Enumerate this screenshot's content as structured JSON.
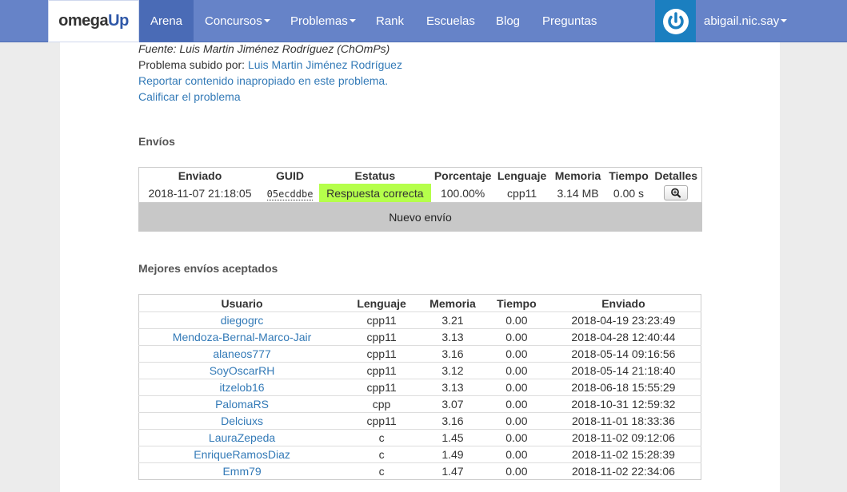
{
  "nav": {
    "brand_part1": "omega",
    "brand_part2": "Up",
    "arena": "Arena",
    "concursos": "Concursos",
    "problemas": "Problemas",
    "rank": "Rank",
    "escuelas": "Escuelas",
    "blog": "Blog",
    "preguntas": "Preguntas",
    "username": "abigail.nic.say"
  },
  "meta": {
    "source": "Fuente: Luis Martin Jiménez Rodríguez (ChOmPs)",
    "uploaded_by_label": "Problema subido por:",
    "uploaded_by_name": "Luis Martin Jiménez Rodríguez",
    "report_link": "Reportar contenido inapropiado en este problema.",
    "rate_link": "Calificar el problema"
  },
  "submissions": {
    "title": "Envíos",
    "headers": [
      "Enviado",
      "GUID",
      "Estatus",
      "Porcentaje",
      "Lenguaje",
      "Memoria",
      "Tiempo",
      "Detalles"
    ],
    "rows": [
      {
        "sent": "2018-11-07 21:18:05",
        "guid": "05ecddbe",
        "status": "Respuesta correcta",
        "percent": "100.00%",
        "lang": "cpp11",
        "memory": "3.14 MB",
        "time": "0.00 s"
      }
    ],
    "new_submission": "Nuevo envío"
  },
  "best": {
    "title": "Mejores envíos aceptados",
    "headers": [
      "Usuario",
      "Lenguaje",
      "Memoria",
      "Tiempo",
      "Enviado"
    ],
    "rows": [
      {
        "user": "diegogrc",
        "lang": "cpp11",
        "memory": "3.21",
        "time": "0.00",
        "sent": "2018-04-19 23:23:49"
      },
      {
        "user": "Mendoza-Bernal-Marco-Jair",
        "lang": "cpp11",
        "memory": "3.13",
        "time": "0.00",
        "sent": "2018-04-28 12:40:44"
      },
      {
        "user": "alaneos777",
        "lang": "cpp11",
        "memory": "3.16",
        "time": "0.00",
        "sent": "2018-05-14 09:16:56"
      },
      {
        "user": "SoyOscarRH",
        "lang": "cpp11",
        "memory": "3.12",
        "time": "0.00",
        "sent": "2018-05-14 21:18:40"
      },
      {
        "user": "itzelob16",
        "lang": "cpp11",
        "memory": "3.13",
        "time": "0.00",
        "sent": "2018-06-18 15:55:29"
      },
      {
        "user": "PalomaRS",
        "lang": "cpp",
        "memory": "3.07",
        "time": "0.00",
        "sent": "2018-10-31 12:59:32"
      },
      {
        "user": "Delciuxs",
        "lang": "cpp11",
        "memory": "3.16",
        "time": "0.00",
        "sent": "2018-11-01 18:33:36"
      },
      {
        "user": "LauraZepeda",
        "lang": "c",
        "memory": "1.45",
        "time": "0.00",
        "sent": "2018-11-02 09:12:06"
      },
      {
        "user": "EnriqueRamosDiaz",
        "lang": "c",
        "memory": "1.49",
        "time": "0.00",
        "sent": "2018-11-02 15:28:39"
      },
      {
        "user": "Emm79",
        "lang": "c",
        "memory": "1.47",
        "time": "0.00",
        "sent": "2018-11-02 22:34:06"
      }
    ]
  },
  "colors": {
    "navbar": "#6683c8",
    "nav_active": "#4a6bb6",
    "avatar": "#1b7fc0",
    "link": "#337ab7",
    "status_ok": "#b5ff4b",
    "nuevo_bg": "#c8c8c8"
  },
  "icons": {
    "avatar": "power-icon",
    "details": "magnifier-icon"
  }
}
